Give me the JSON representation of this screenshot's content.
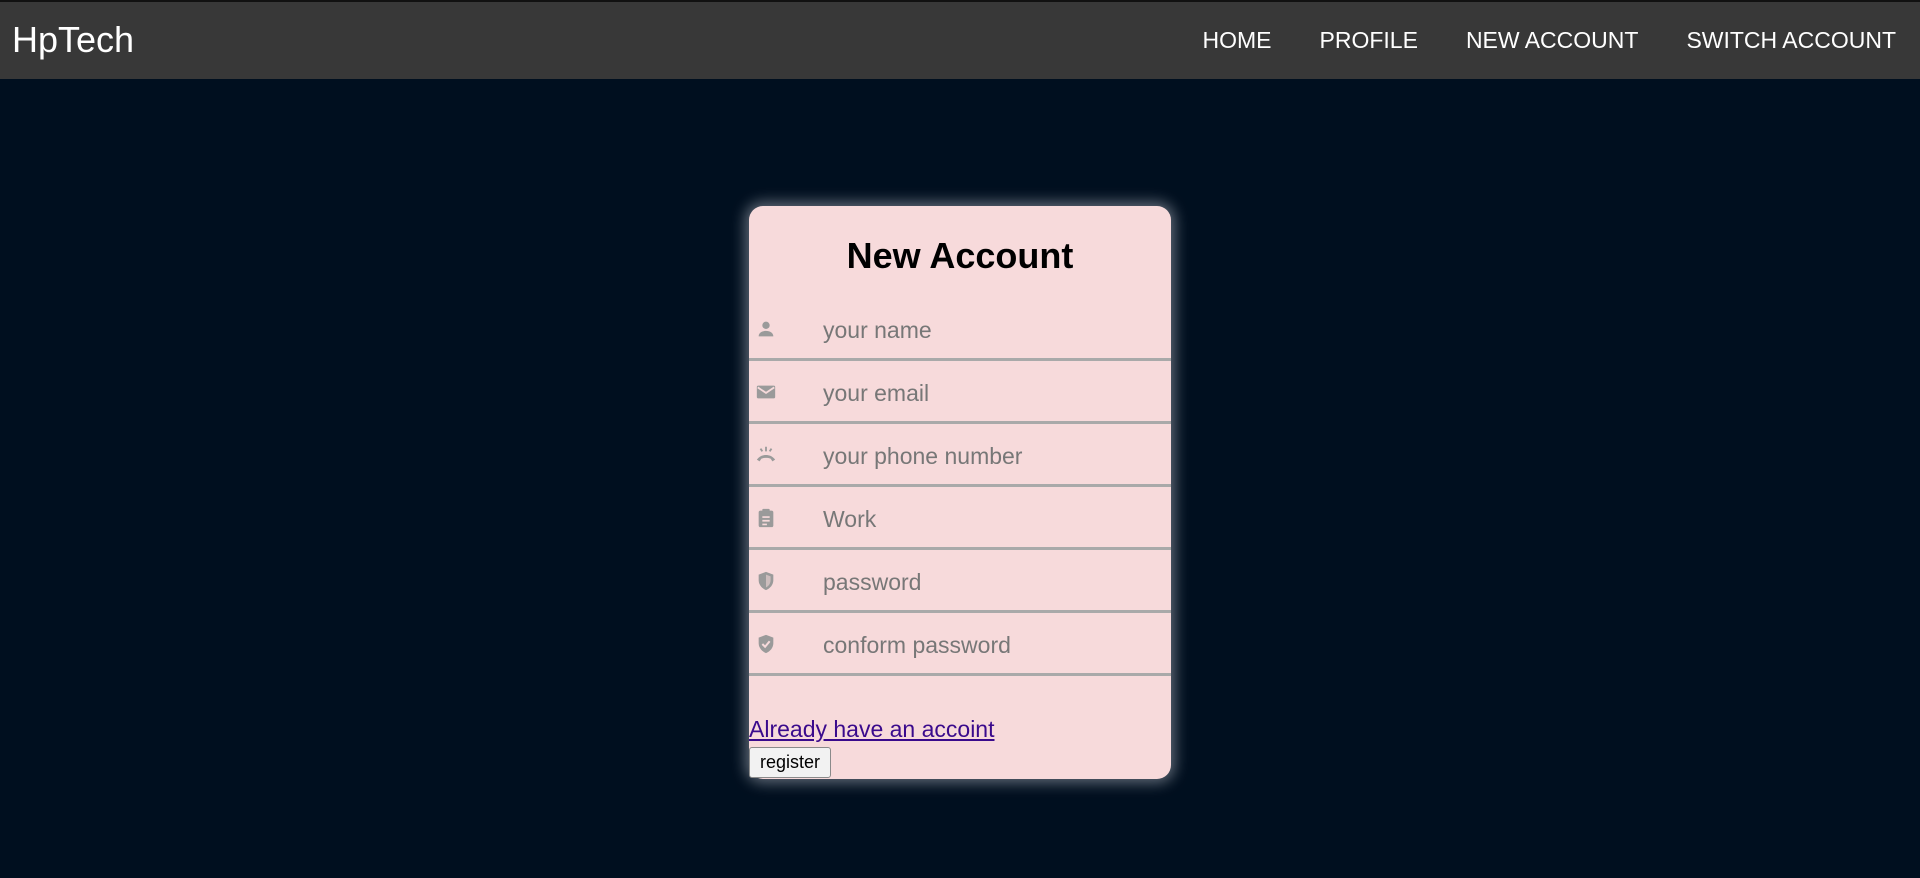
{
  "header": {
    "brand": "HpTech",
    "nav": [
      {
        "label": "HOME"
      },
      {
        "label": "PROFILE"
      },
      {
        "label": "NEW ACCOUNT"
      },
      {
        "label": "SWITCH ACCOUNT"
      }
    ]
  },
  "form": {
    "title": "New Account",
    "fields": [
      {
        "placeholder": "your name",
        "value": "",
        "icon": "person-icon"
      },
      {
        "placeholder": "your email",
        "value": "",
        "icon": "mail-icon"
      },
      {
        "placeholder": "your phone number",
        "value": "",
        "icon": "phone-icon"
      },
      {
        "placeholder": "Work",
        "value": "",
        "icon": "clipboard-icon"
      },
      {
        "placeholder": "password",
        "value": "",
        "icon": "shield-icon"
      },
      {
        "placeholder": "conform password",
        "value": "",
        "icon": "verified-shield-icon"
      }
    ],
    "login_link": "Already have an accoint",
    "register_label": "register"
  },
  "colors": {
    "background": "#000f1f",
    "topbar": "#383838",
    "card": "#f7dadb",
    "icon": "#9a9a9a",
    "link": "#3a0a8c"
  }
}
